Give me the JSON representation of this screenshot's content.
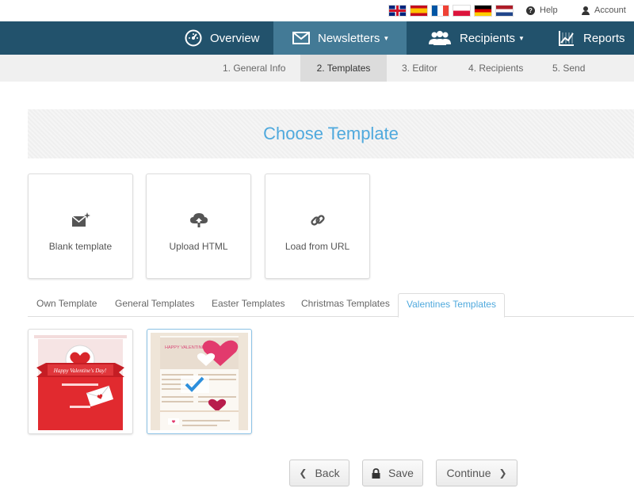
{
  "topbar": {
    "languages": [
      "English",
      "Spanish",
      "French",
      "Polish",
      "German",
      "Dutch"
    ],
    "help_label": "Help",
    "account_label": "Account"
  },
  "nav": {
    "overview": "Overview",
    "newsletters": "Newsletters",
    "recipients": "Recipients",
    "reports": "Reports",
    "active": "Newsletters"
  },
  "steps": {
    "items": [
      "1. General Info",
      "2. Templates",
      "3. Editor",
      "4. Recipients",
      "5. Send"
    ],
    "active_index": 1
  },
  "choose": {
    "title": "Choose Template"
  },
  "options": {
    "blank": "Blank template",
    "upload": "Upload HTML",
    "url": "Load from URL"
  },
  "tabs": {
    "items": [
      "Own Template",
      "General Templates",
      "Easter Templates",
      "Christmas Templates",
      "Valentines Templates"
    ],
    "active": "Valentines Templates"
  },
  "thumbs": {
    "t1_banner": "Happy Valentine's Day!",
    "t2_heading": "HAPPY VALENTINE'S DAY",
    "selected_index": 1
  },
  "buttons": {
    "back": "Back",
    "save": "Save",
    "continue": "Continue"
  },
  "colors": {
    "nav_bg": "#22526c",
    "nav_active": "#437a96",
    "accent": "#4fa9dd"
  }
}
